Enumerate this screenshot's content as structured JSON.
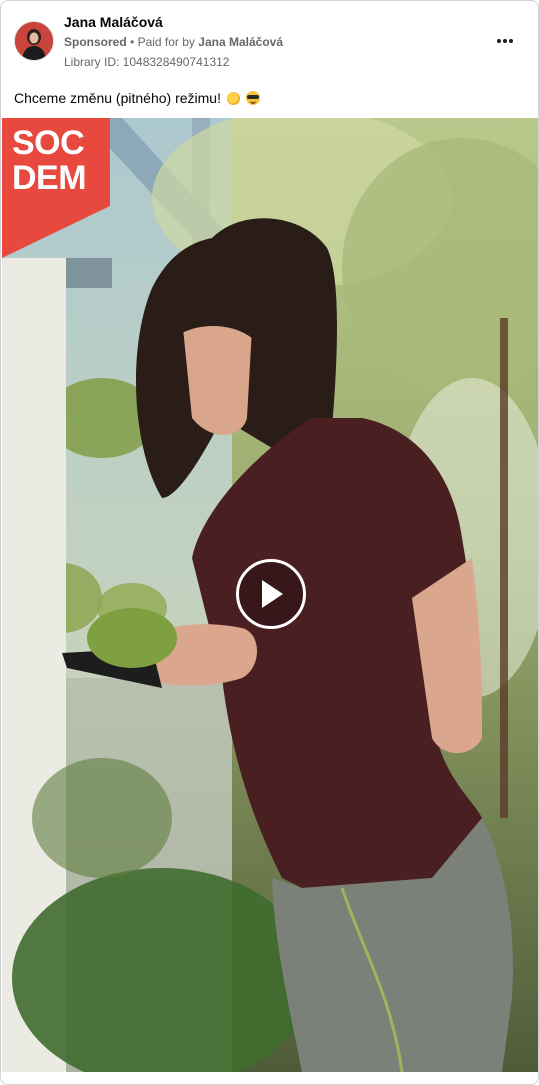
{
  "post": {
    "author": "Jana Maláčová",
    "sponsored_label": "Sponsored",
    "separator": "•",
    "paid_for_prefix": "Paid for by",
    "paid_for_name": "Jana Maláčová",
    "library_id": "Library ID: 1048328490741312",
    "caption": "Chceme změnu (pitného) režimu!",
    "caption_emojis": [
      "sun-emoji-icon",
      "sunglasses-face-emoji-icon"
    ]
  },
  "video": {
    "logo_lines": [
      "SOC",
      "DEM"
    ],
    "logo_color": "#e8493f",
    "play_icon": "play-icon"
  },
  "colors": {
    "text_primary": "#050505",
    "text_secondary": "#65676b",
    "border": "#cfd2d6"
  }
}
